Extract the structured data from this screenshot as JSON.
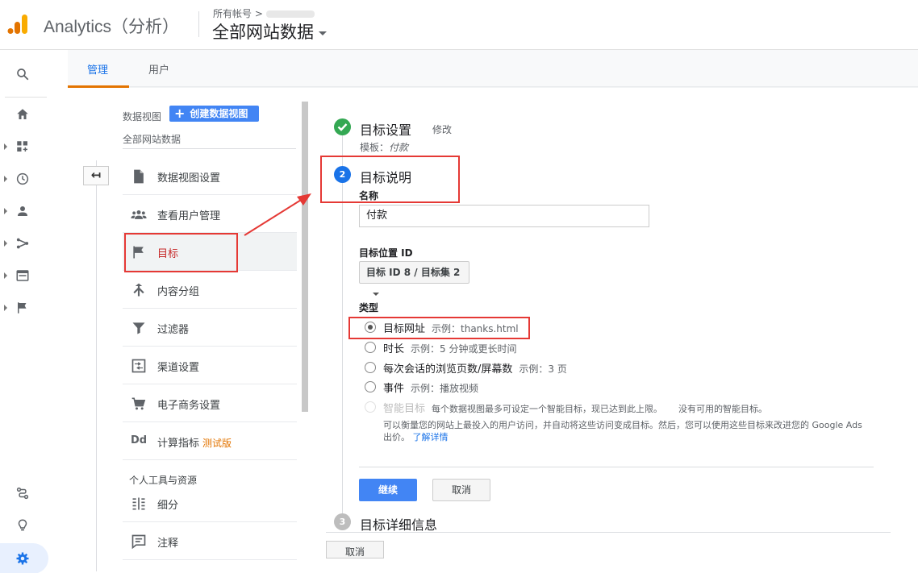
{
  "header": {
    "app_name": "Analytics（分析）",
    "account_small": "所有帐号 >",
    "property_name": "全部网站数据"
  },
  "tabs": [
    {
      "label": "管理",
      "active": true
    },
    {
      "label": "用户",
      "active": false
    }
  ],
  "view": {
    "label": "数据视图",
    "create_button": "创建数据视图",
    "name": "全部网站数据"
  },
  "nav": {
    "items": [
      {
        "label": "数据视图设置",
        "icon": "document-icon"
      },
      {
        "label": "查看用户管理",
        "icon": "people-icon"
      },
      {
        "label": "目标",
        "icon": "flag-icon",
        "active": true
      },
      {
        "label": "内容分组",
        "icon": "merge-icon"
      },
      {
        "label": "过滤器",
        "icon": "filter-icon"
      },
      {
        "label": "渠道设置",
        "icon": "channel-icon"
      },
      {
        "label": "电子商务设置",
        "icon": "cart-icon"
      },
      {
        "label": "计算指标",
        "icon": "dd-icon",
        "badge": "测试版"
      }
    ],
    "section_title": "个人工具与资源",
    "personal_items": [
      {
        "label": "细分",
        "icon": "segment-icon"
      },
      {
        "label": "注释",
        "icon": "annotation-icon"
      }
    ]
  },
  "goal": {
    "step1": {
      "number": "",
      "title": "目标设置",
      "edit": "修改",
      "template_label": "模板：",
      "template_value": "付款"
    },
    "step2": {
      "number": "2",
      "title": "目标说明"
    },
    "name_label": "名称",
    "name_value": "付款",
    "position_label": "目标位置 ID",
    "position_value": "目标 ID 8 / 目标集 2",
    "type_label": "类型",
    "types": [
      {
        "label": "目标网址",
        "example": "示例：thanks.html",
        "checked": true
      },
      {
        "label": "时长",
        "example": "示例：5 分钟或更长时间"
      },
      {
        "label": "每次会话的浏览页数/屏幕数",
        "example": "示例：3 页"
      },
      {
        "label": "事件",
        "example": "示例：播放视频"
      },
      {
        "label": "智能目标",
        "example": "每个数据视图最多可设定一个智能目标，现已达到此上限。",
        "extra": "没有可用的智能目标。",
        "disabled": true
      }
    ],
    "smart_note": "可以衡量您的网站上最投入的用户访问，并自动将这些访问变成目标。然后，您可以使用这些目标来改进您的 Google Ads 出价。",
    "learn_more": "了解详情",
    "continue": "继续",
    "cancel": "取消",
    "step3": {
      "number": "3",
      "title": "目标详细信息"
    },
    "bottom_cancel": "取消"
  },
  "colors": {
    "accent": "#1a73e8",
    "tab_underline": "#e37400",
    "success": "#34a853",
    "step_active": "#4285f4",
    "annotation": "#e53935"
  }
}
